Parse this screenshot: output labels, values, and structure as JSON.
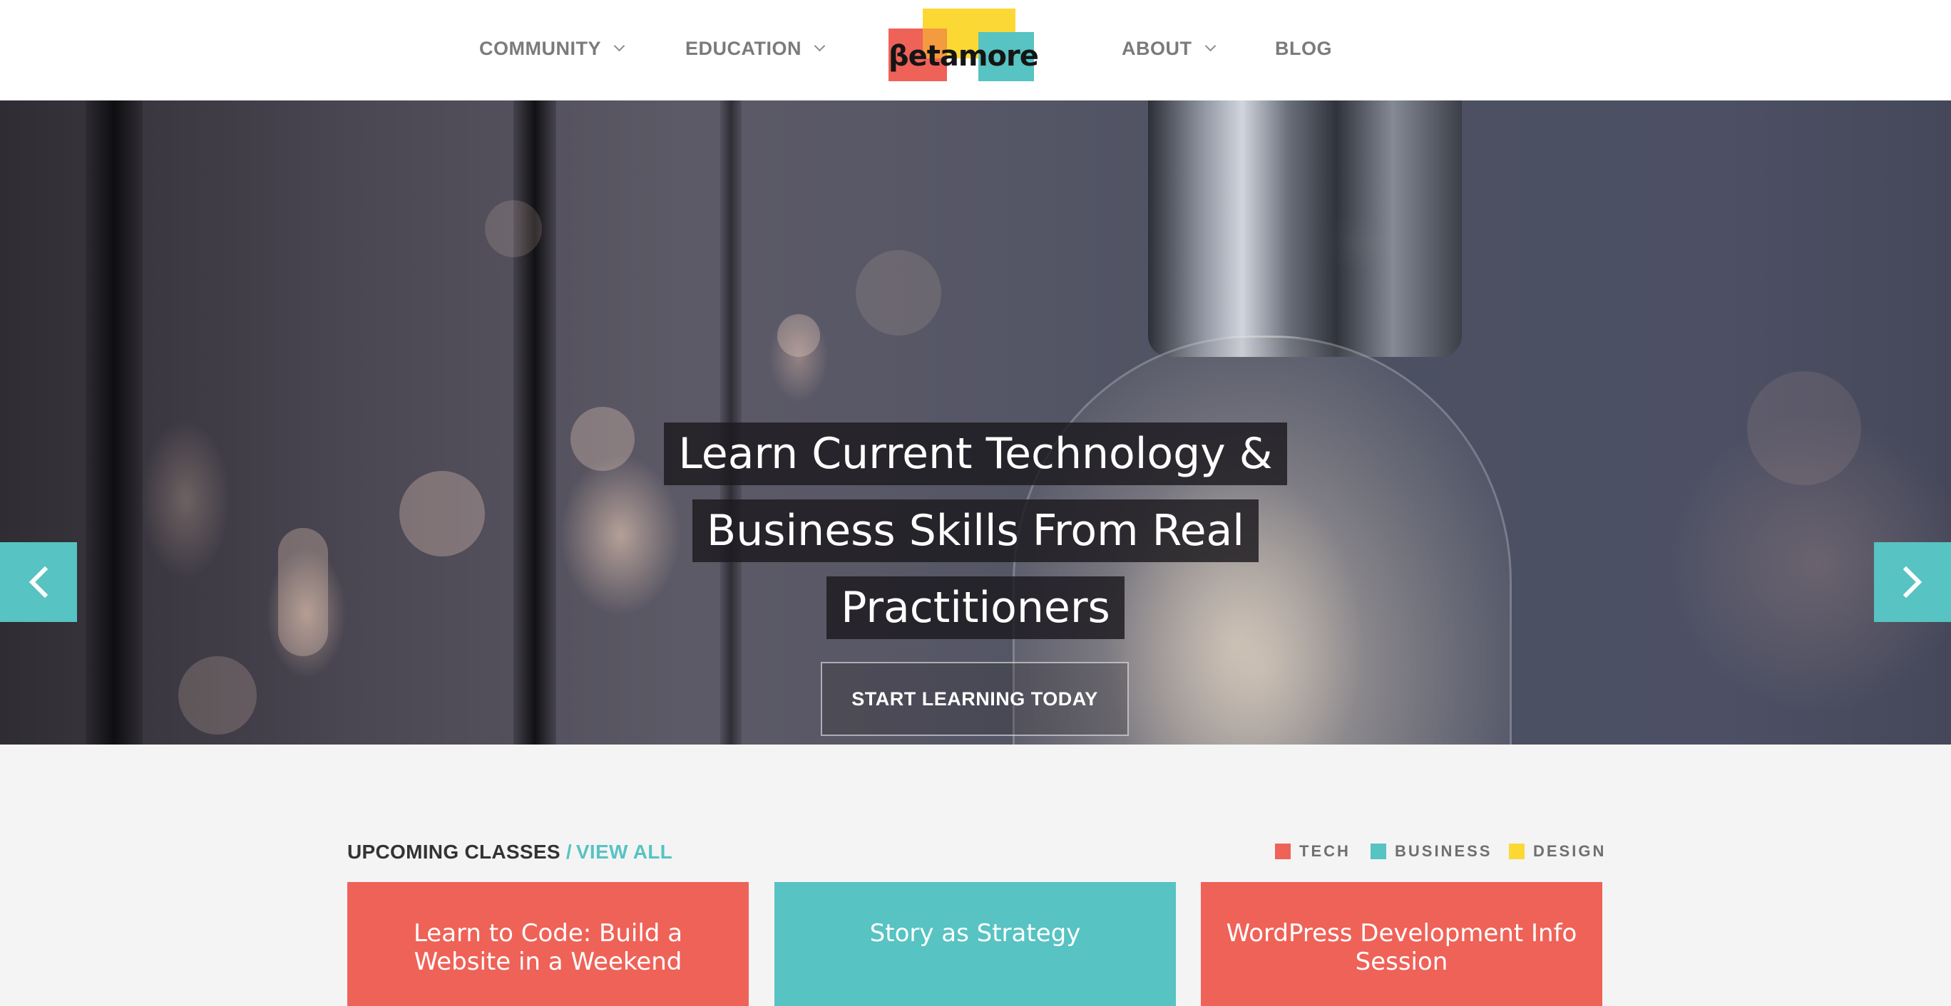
{
  "header": {
    "nav_left": [
      {
        "label": "COMMUNITY",
        "has_dropdown": true
      },
      {
        "label": "EDUCATION",
        "has_dropdown": true
      }
    ],
    "logo": {
      "text": "βetamore"
    },
    "nav_right": [
      {
        "label": "ABOUT",
        "has_dropdown": true
      },
      {
        "label": "BLOG",
        "has_dropdown": false
      }
    ]
  },
  "hero": {
    "headline_lines": [
      "Learn Current Technology &",
      "Business Skills From Real",
      "Practitioners"
    ],
    "cta_label": "START LEARNING TODAY",
    "prev_arrow_icon": "chevron-left-icon",
    "next_arrow_icon": "chevron-right-icon"
  },
  "upcoming": {
    "title": "UPCOMING CLASSES",
    "separator": "/",
    "view_all_label": "VIEW ALL",
    "legend": [
      {
        "label": "TECH",
        "color": "#ef6258"
      },
      {
        "label": "BUSINESS",
        "color": "#57c3c2"
      },
      {
        "label": "DESIGN",
        "color": "#fcd835"
      }
    ],
    "classes": [
      {
        "title": "Learn to Code: Build a Website in a Weekend",
        "category": "TECH",
        "color": "#ef6258"
      },
      {
        "title": "Story as Strategy",
        "category": "BUSINESS",
        "color": "#57c3c2"
      },
      {
        "title": "WordPress Development Info Session",
        "category": "TECH",
        "color": "#ef6258"
      }
    ]
  },
  "colors": {
    "accent_teal": "#57c3c2",
    "accent_red": "#ef6258",
    "accent_yellow": "#fcd835",
    "nav_text": "#7b7b7b"
  }
}
